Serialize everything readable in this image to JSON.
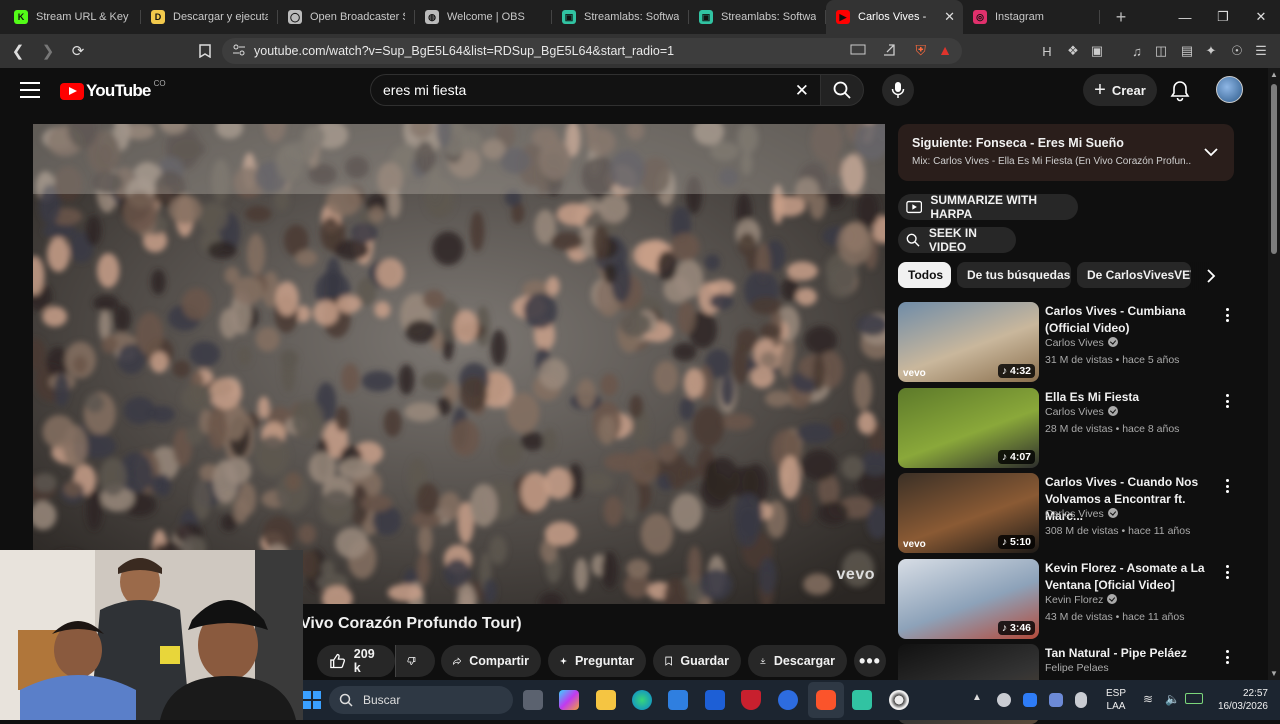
{
  "browser": {
    "tabs": [
      {
        "title": "Stream URL & Key - K",
        "icon": "kick-icon",
        "color": "#53fc18",
        "glyph": "K"
      },
      {
        "title": "Descargar y ejecutar",
        "icon": "download-site-icon",
        "color": "#f2c94c",
        "glyph": "D"
      },
      {
        "title": "Open Broadcaster Sof",
        "icon": "github-icon",
        "color": "#bbbbbb",
        "glyph": "◯"
      },
      {
        "title": "Welcome | OBS",
        "icon": "globe-icon",
        "color": "#bbbbbb",
        "glyph": "◍"
      },
      {
        "title": "Streamlabs: Software",
        "icon": "streamlabs-icon",
        "color": "#31c3a2",
        "glyph": "▣"
      },
      {
        "title": "Streamlabs: Software",
        "icon": "streamlabs-icon",
        "color": "#31c3a2",
        "glyph": "▣"
      },
      {
        "title": "Carlos Vives -",
        "icon": "youtube-icon",
        "color": "#ff0000",
        "glyph": "▶",
        "active": true
      },
      {
        "title": "Instagram",
        "icon": "instagram-icon",
        "color": "#e1306c",
        "glyph": "◎"
      }
    ],
    "new_tab": "+",
    "url": "youtube.com/watch?v=Sup_BgE5L64&list=RDSup_BgE5L64&start_radio=1"
  },
  "youtube": {
    "logo_text": "YouTube",
    "country": "CO",
    "search_value": "eres mi fiesta",
    "create_label": "Crear",
    "video": {
      "title": "Vivo Corazón Profundo Tour)",
      "watermark": "vevo",
      "likes": "209 k",
      "share": "Compartir",
      "ask": "Preguntar",
      "save": "Guardar",
      "download": "Descargar"
    },
    "up_next": {
      "line1": "Siguiente: Fonseca - Eres Mi Sueño",
      "line2": "Mix: Carlos Vives - Ella Es Mi Fiesta (En Vivo Corazón Profun..."
    },
    "harpa_label": "SUMMARIZE WITH HARPA",
    "seek_label": "SEEK IN VIDEO",
    "chips": [
      "Todos",
      "De tus búsquedas",
      "De CarlosVivesVEVO"
    ],
    "recommendations": [
      {
        "title": "Carlos Vives - Cumbiana (Official Video)",
        "channel": "Carlos Vives",
        "views": "31 M de vistas",
        "age": "hace 5 años",
        "duration": "4:32",
        "vevo": "vevo",
        "colors": [
          "#6f8ca8",
          "#c9b79c",
          "#8a6f4d"
        ]
      },
      {
        "title": "Ella Es Mi Fiesta",
        "channel": "Carlos Vives",
        "views": "28 M de vistas",
        "age": "hace 8 años",
        "duration": "4:07",
        "vevo": "",
        "colors": [
          "#5d7a2a",
          "#8aa83a",
          "#2d2d2d"
        ]
      },
      {
        "title": "Carlos Vives - Cuando Nos Volvamos a Encontrar ft. Marc...",
        "channel": "Carlos Vives",
        "views": "308 M de vistas",
        "age": "hace 11 años",
        "duration": "5:10",
        "vevo": "vevo",
        "colors": [
          "#3b3026",
          "#8a5a34",
          "#1d1a17"
        ]
      },
      {
        "title": "Kevin Florez - Asomate a La Ventana [Oficial Video]",
        "channel": "Kevin Florez",
        "views": "43 M de vistas",
        "age": "hace 11 años",
        "duration": "3:46",
        "vevo": "",
        "colors": [
          "#d7dde5",
          "#8da2b9",
          "#b44a3a"
        ]
      },
      {
        "title": "Tan Natural - Pipe Peláez",
        "channel": "Felipe Pelaes",
        "views": "",
        "age": "",
        "duration": "",
        "vevo": "",
        "colors": [
          "#111111",
          "#333333",
          "#5a4a3a"
        ]
      }
    ]
  },
  "taskbar": {
    "search_placeholder": "Buscar",
    "language": "ESP",
    "layout": "LAA",
    "time": "22:57",
    "date": "16/03/2026"
  }
}
